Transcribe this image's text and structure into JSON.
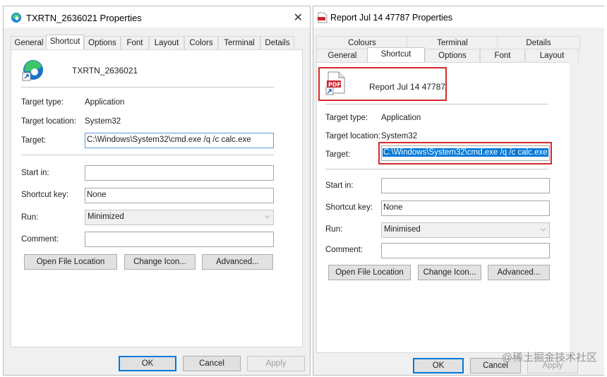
{
  "left": {
    "title": "TXRTN_2636021 Properties",
    "close": "✕",
    "tabs": [
      "General",
      "Shortcut",
      "Options",
      "Font",
      "Layout",
      "Colors",
      "Terminal",
      "Details"
    ],
    "name": "TXRTN_2636021",
    "target_type_label": "Target type:",
    "target_type": "Application",
    "target_location_label": "Target location:",
    "target_location": "System32",
    "target_label": "Target:",
    "target": "C:\\Windows\\System32\\cmd.exe /q /c calc.exe",
    "start_in_label": "Start in:",
    "start_in": "",
    "shortcut_key_label": "Shortcut key:",
    "shortcut_key": "None",
    "run_label": "Run:",
    "run": "Minimized",
    "comment_label": "Comment:",
    "comment": "",
    "buttons": {
      "open_file_location": "Open File Location",
      "change_icon": "Change Icon...",
      "advanced": "Advanced..."
    },
    "footer": {
      "ok": "OK",
      "cancel": "Cancel",
      "apply": "Apply"
    }
  },
  "right": {
    "title": "Report Jul 14 47787 Properties",
    "tabs_top": [
      "Colours",
      "Terminal",
      "Details"
    ],
    "tabs_bottom": [
      "General",
      "Shortcut",
      "Options",
      "Font",
      "Layout"
    ],
    "name": "Report Jul 14 47787",
    "target_type_label": "Target type:",
    "target_type": "Application",
    "target_location_label": "Target location:",
    "target_location": "System32",
    "target_label": "Target:",
    "target": "C:\\Windows\\System32\\cmd.exe /q /c calc.exe",
    "start_in_label": "Start in:",
    "start_in": "",
    "shortcut_key_label": "Shortcut key:",
    "shortcut_key": "None",
    "run_label": "Run:",
    "run": "Minimised",
    "comment_label": "Comment:",
    "comment": "",
    "buttons": {
      "open_file_location": "Open File Location",
      "change_icon": "Change Icon...",
      "advanced": "Advanced..."
    },
    "footer": {
      "ok": "OK",
      "cancel": "Cancel",
      "apply": "Apply"
    },
    "pdf_icon_text": "PDF"
  },
  "watermark": "@稀土掘金技术社区",
  "colors": {
    "accent": "#0078d7",
    "highlight": "#d42a2a"
  },
  "icons": {
    "left_title": "edge-icon",
    "right_title": "pdf-icon",
    "close": "close-icon"
  }
}
